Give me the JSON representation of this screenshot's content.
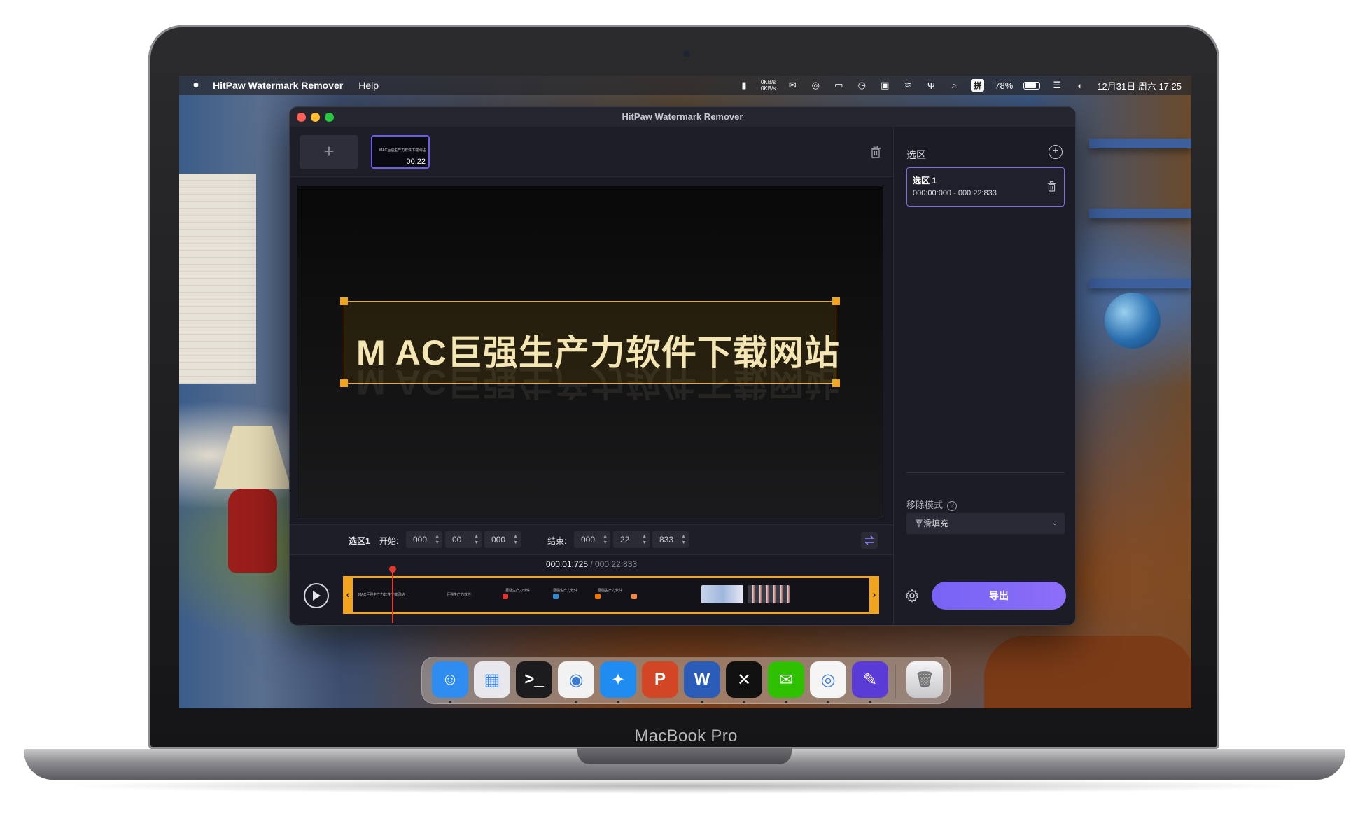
{
  "device": {
    "bezel_label": "MacBook Pro"
  },
  "menubar": {
    "app_name": "HitPaw Watermark Remover",
    "items": [
      "Help"
    ],
    "net_up": "0KB/s",
    "net_down": "0KB/s",
    "ime": "拼",
    "battery": "78%",
    "clock": "12月31日 周六  17:25"
  },
  "window": {
    "title": "HitPaw Watermark Remover"
  },
  "media": {
    "add_label": "+",
    "thumb_caption": "MAC巨强生产力软件下载网站",
    "thumb_duration": "00:22"
  },
  "preview": {
    "watermark_text": "M AC巨强生产力软件下载网站"
  },
  "time_controls": {
    "region_label": "选区1",
    "start_label": "开始:",
    "start": [
      "000",
      "00",
      "000"
    ],
    "end_label": "结束:",
    "end": [
      "000",
      "22",
      "833"
    ],
    "current_time": "000:01:725",
    "total_time": " / 000:22:833"
  },
  "timeline": {
    "frame_caption_1": "MAC巨强生产力软件下载网站",
    "frame_caption_2": "巨强生产力软件"
  },
  "side_panel": {
    "title": "选区",
    "region": {
      "name": "选区 1",
      "range": "000:00:000 - 000:22:833"
    },
    "mode_label": "移除模式",
    "mode_value": "平滑填充",
    "export_label": "导出"
  },
  "dock": {
    "items": [
      {
        "icon": "finder-icon",
        "bg": "#2f8cf0",
        "glyph": "☺"
      },
      {
        "icon": "launchpad-icon",
        "bg": "#e8e8ec",
        "glyph": "▦"
      },
      {
        "icon": "terminal-icon",
        "bg": "#1c1c1e",
        "glyph": ">_"
      },
      {
        "icon": "chrome-icon",
        "bg": "#f2f2f2",
        "glyph": "◉"
      },
      {
        "icon": "safari-icon",
        "bg": "#1f8cf2",
        "glyph": "✦"
      },
      {
        "icon": "powerpoint-icon",
        "bg": "#d24625",
        "glyph": "P"
      },
      {
        "icon": "word-icon",
        "bg": "#2b5cb8",
        "glyph": "W"
      },
      {
        "icon": "capcut-icon",
        "bg": "#111111",
        "glyph": "✕"
      },
      {
        "icon": "wechat-icon",
        "bg": "#2dc100",
        "glyph": "✉"
      },
      {
        "icon": "qq-icon",
        "bg": "#f5f5f5",
        "glyph": "◎"
      },
      {
        "icon": "hitpaw-icon",
        "bg": "#5b3bd6",
        "glyph": "✎"
      }
    ],
    "trash_icon": "trash-icon"
  }
}
